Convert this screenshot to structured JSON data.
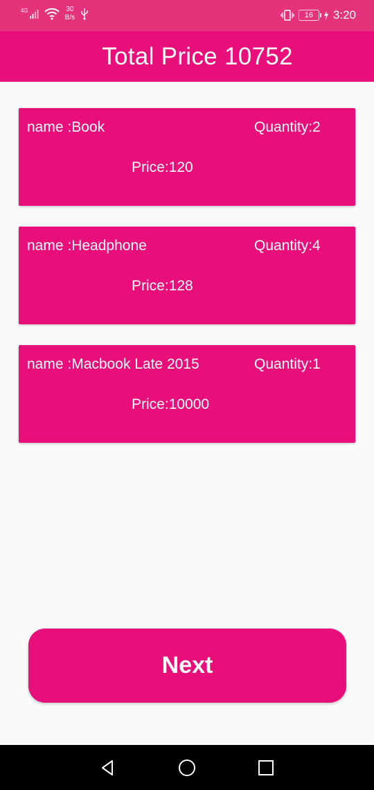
{
  "status_bar": {
    "network": "4G",
    "net_speed_value": "30",
    "net_speed_unit": "B/s",
    "battery_level": "16",
    "time": "3:20"
  },
  "header": {
    "title": "Total Price 10752"
  },
  "cart_items": [
    {
      "name": "name :Book",
      "quantity": "Quantity:2",
      "price": "Price:120"
    },
    {
      "name": "name :Headphone",
      "quantity": "Quantity:4",
      "price": "Price:128"
    },
    {
      "name": "name :Macbook Late 2015",
      "quantity": "Quantity:1",
      "price": "Price:10000"
    }
  ],
  "actions": {
    "next_label": "Next"
  },
  "colors": {
    "primary": "#e80f7a",
    "status_bar": "#e4337a",
    "background": "#fafafa",
    "text_on_primary": "#ffffff"
  },
  "icons": {
    "status_left": [
      "signal-icon",
      "wifi-icon",
      "usb-icon"
    ],
    "status_right": [
      "vibrate-icon",
      "battery-icon",
      "charging-icon"
    ],
    "navigation": [
      "back-icon",
      "home-icon",
      "recents-icon"
    ]
  }
}
